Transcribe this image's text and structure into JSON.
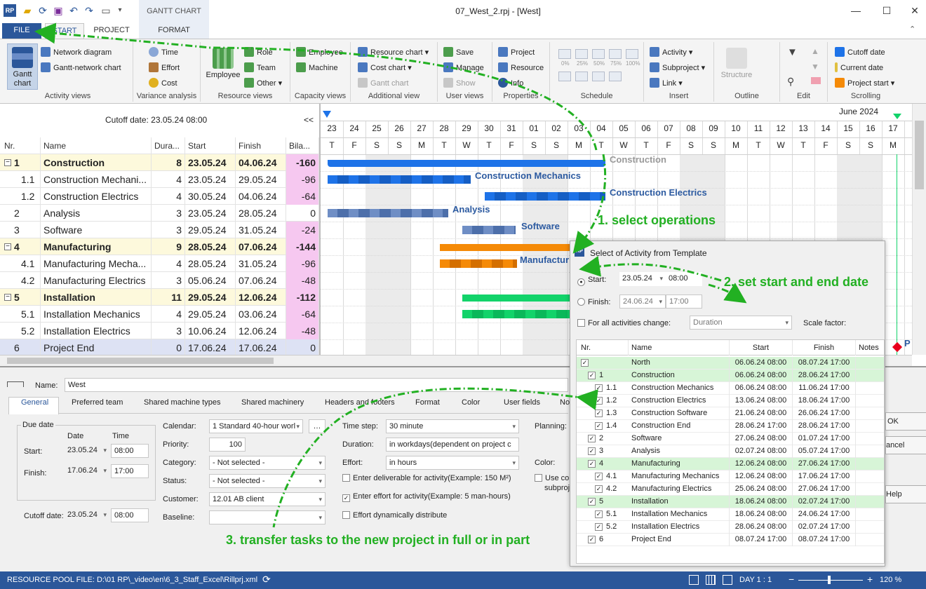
{
  "window": {
    "title": "07_West_2.rpj - [West]",
    "context_tab": "GANTT CHART"
  },
  "tabs": [
    {
      "label": "FILE"
    },
    {
      "label": "START"
    },
    {
      "label": "PROJECT"
    },
    {
      "label": "FORMAT"
    }
  ],
  "ribbon": {
    "activity_views": {
      "label": "Activity views",
      "gantt": "Gantt chart",
      "network": "Network diagram",
      "gantt_network": "Gantt-network chart"
    },
    "variance": {
      "label": "Variance analysis",
      "time": "Time",
      "effort": "Effort",
      "cost": "Cost"
    },
    "resource_views": {
      "label": "Resource views",
      "employee": "Employee",
      "role": "Role",
      "team": "Team",
      "other": "Other"
    },
    "capacity_views": {
      "label": "Capacity views",
      "employee": "Employee",
      "machine": "Machine"
    },
    "additional_view": {
      "label": "Additional view",
      "resource_chart": "Resource chart",
      "cost_chart": "Cost chart",
      "gantt_chart": "Gantt chart"
    },
    "user_views": {
      "label": "User views",
      "save": "Save",
      "manage": "Manage",
      "show": "Show"
    },
    "properties": {
      "label": "Properties",
      "project": "Project",
      "resource": "Resource",
      "info": "Info"
    },
    "schedule": {
      "label": "Schedule",
      "pcts": [
        "0%",
        "25%",
        "50%",
        "75%",
        "100%"
      ]
    },
    "insert": {
      "label": "Insert",
      "activity": "Activity",
      "subproject": "Subproject",
      "link": "Link"
    },
    "outline": {
      "label": "Outline",
      "structure": "Structure"
    },
    "edit": {
      "label": "Edit"
    },
    "scrolling": {
      "label": "Scrolling",
      "cutoff": "Cutoff date",
      "current": "Current date",
      "project_start": "Project start"
    }
  },
  "left": {
    "cutoff": "Cutoff date: 23.05.24 08:00",
    "collapse": "<<",
    "headers": [
      "Nr.",
      "Name",
      "Dura...",
      "Start",
      "Finish",
      "Bila..."
    ],
    "rows": [
      {
        "nr": "1",
        "name": "Construction",
        "dur": "8",
        "start": "23.05.24",
        "finish": "04.06.24",
        "bal": "-160",
        "sum": true
      },
      {
        "nr": "1.1",
        "name": "Construction Mechani...",
        "dur": "4",
        "start": "23.05.24",
        "finish": "29.05.24",
        "bal": "-96"
      },
      {
        "nr": "1.2",
        "name": "Construction Electrics",
        "dur": "4",
        "start": "30.05.24",
        "finish": "04.06.24",
        "bal": "-64"
      },
      {
        "nr": "2",
        "name": "Analysis",
        "dur": "3",
        "start": "23.05.24",
        "finish": "28.05.24",
        "bal": "0"
      },
      {
        "nr": "3",
        "name": "Software",
        "dur": "3",
        "start": "29.05.24",
        "finish": "31.05.24",
        "bal": "-24"
      },
      {
        "nr": "4",
        "name": "Manufacturing",
        "dur": "9",
        "start": "28.05.24",
        "finish": "07.06.24",
        "bal": "-144",
        "sum": true
      },
      {
        "nr": "4.1",
        "name": "Manufacturing Mecha...",
        "dur": "4",
        "start": "28.05.24",
        "finish": "31.05.24",
        "bal": "-96"
      },
      {
        "nr": "4.2",
        "name": "Manufacturing Electrics",
        "dur": "3",
        "start": "05.06.24",
        "finish": "07.06.24",
        "bal": "-48"
      },
      {
        "nr": "5",
        "name": "Installation",
        "dur": "11",
        "start": "29.05.24",
        "finish": "12.06.24",
        "bal": "-112",
        "sum": true
      },
      {
        "nr": "5.1",
        "name": "Installation Mechanics",
        "dur": "4",
        "start": "29.05.24",
        "finish": "03.06.24",
        "bal": "-64"
      },
      {
        "nr": "5.2",
        "name": "Installation Electrics",
        "dur": "3",
        "start": "10.06.24",
        "finish": "12.06.24",
        "bal": "-48"
      },
      {
        "nr": "6",
        "name": "Project End",
        "dur": "0",
        "start": "17.06.24",
        "finish": "17.06.24",
        "bal": "0",
        "last": true
      }
    ]
  },
  "gantt": {
    "month": "June 2024",
    "days": [
      "23",
      "24",
      "25",
      "26",
      "27",
      "28",
      "29",
      "30",
      "31",
      "01",
      "02",
      "03",
      "04",
      "05",
      "06",
      "07",
      "08",
      "09",
      "10",
      "11",
      "12",
      "13",
      "14",
      "15",
      "16",
      "17"
    ],
    "letters": [
      "T",
      "F",
      "S",
      "S",
      "M",
      "T",
      "W",
      "T",
      "F",
      "S",
      "S",
      "M",
      "T",
      "W",
      "T",
      "F",
      "S",
      "S",
      "M",
      "T",
      "W",
      "T",
      "F",
      "S",
      "S",
      "M"
    ],
    "labels": {
      "construction": "Construction",
      "cmech": "Construction Mechanics",
      "celec": "Construction Electrics",
      "analysis": "Analysis",
      "software": "Software",
      "manuf": "Manufactur",
      "p": "P"
    }
  },
  "props": {
    "name_label": "Name:",
    "name_value": "West",
    "tabs": [
      "General",
      "Preferred team",
      "Shared machine types",
      "Shared machinery",
      "Headers and footers",
      "Format",
      "Color",
      "User fields",
      "No"
    ],
    "due_date": "Due date",
    "date_hdr": "Date",
    "time_hdr": "Time",
    "start_label": "Start:",
    "start_date": "23.05.24",
    "start_time": "08:00",
    "finish_label": "Finish:",
    "finish_date": "17.06.24",
    "finish_time": "17:00",
    "cutoff_label": "Cutoff date:",
    "cutoff_date": "23.05.24",
    "cutoff_time": "08:00",
    "calendar_label": "Calendar:",
    "calendar_value": "1 Standard 40-hour worl",
    "priority_label": "Priority:",
    "priority_value": "100",
    "category_label": "Category:",
    "category_value": "- Not selected -",
    "status_label": "Status:",
    "status_value": "- Not selected -",
    "customer_label": "Customer:",
    "customer_value": "12.01 AB client",
    "baseline_label": "Baseline:",
    "timestep_label": "Time step:",
    "timestep_value": "30 minute",
    "duration_label": "Duration:",
    "duration_value": "in workdays(dependent on project c",
    "effort_label": "Effort:",
    "effort_value": "in hours",
    "cb1": "Enter deliverable for activity(Example: 150 M²)",
    "cb2": "Enter effort for activity(Example: 5 man-hours)",
    "cb3": "Effort dynamically distribute",
    "planning_label": "Planning:",
    "color_label": "Color:",
    "use_co": "Use co",
    "subproj": "subproj"
  },
  "dialog": {
    "title": "Select of Activity from Template",
    "start_label": "Start:",
    "start_date": "23.05.24",
    "start_time": "08:00",
    "finish_label": "Finish:",
    "finish_date": "24.06.24",
    "finish_time": "17:00",
    "for_all": "For all activities change:",
    "for_all_value": "Duration",
    "scale": "Scale factor:",
    "headers": [
      "Nr.",
      "Name",
      "Start",
      "Finish",
      "Notes"
    ],
    "rows": [
      {
        "nr": "",
        "name": "North",
        "start": "06.06.24 08:00",
        "finish": "08.07.24 17:00",
        "lvl": 0,
        "green": true
      },
      {
        "nr": "1",
        "name": "Construction",
        "start": "06.06.24 08:00",
        "finish": "28.06.24 17:00",
        "lvl": 1,
        "green": true
      },
      {
        "nr": "1.1",
        "name": "Construction Mechanics",
        "start": "06.06.24 08:00",
        "finish": "11.06.24 17:00",
        "lvl": 2
      },
      {
        "nr": "1.2",
        "name": "Construction Electrics",
        "start": "13.06.24 08:00",
        "finish": "18.06.24 17:00",
        "lvl": 2
      },
      {
        "nr": "1.3",
        "name": "Construction Software",
        "start": "21.06.24 08:00",
        "finish": "26.06.24 17:00",
        "lvl": 2
      },
      {
        "nr": "1.4",
        "name": "Construction End",
        "start": "28.06.24 17:00",
        "finish": "28.06.24 17:00",
        "lvl": 2
      },
      {
        "nr": "2",
        "name": "Software",
        "start": "27.06.24 08:00",
        "finish": "01.07.24 17:00",
        "lvl": 1
      },
      {
        "nr": "3",
        "name": "Analysis",
        "start": "02.07.24 08:00",
        "finish": "05.07.24 17:00",
        "lvl": 1
      },
      {
        "nr": "4",
        "name": "Manufacturing",
        "start": "12.06.24 08:00",
        "finish": "27.06.24 17:00",
        "lvl": 1,
        "green": true
      },
      {
        "nr": "4.1",
        "name": "Manufacturing Mechanics",
        "start": "12.06.24 08:00",
        "finish": "17.06.24 17:00",
        "lvl": 2
      },
      {
        "nr": "4.2",
        "name": "Manufacturing Electrics",
        "start": "25.06.24 08:00",
        "finish": "27.06.24 17:00",
        "lvl": 2
      },
      {
        "nr": "5",
        "name": "Installation",
        "start": "18.06.24 08:00",
        "finish": "02.07.24 17:00",
        "lvl": 1,
        "green": true
      },
      {
        "nr": "5.1",
        "name": "Installation Mechanics",
        "start": "18.06.24 08:00",
        "finish": "24.06.24 17:00",
        "lvl": 2
      },
      {
        "nr": "5.2",
        "name": "Installation Electrics",
        "start": "28.06.24 08:00",
        "finish": "02.07.24 17:00",
        "lvl": 2
      },
      {
        "nr": "6",
        "name": "Project End",
        "start": "08.07.24 17:00",
        "finish": "08.07.24 17:00",
        "lvl": 1
      }
    ],
    "ok": "OK",
    "cancel": "ancel",
    "help": "Help"
  },
  "annotations": {
    "a1": "1. select operations",
    "a2": "2. set start and end date",
    "a3": "3. transfer tasks to the new project in full or in part"
  },
  "status": {
    "pool": "RESOURCE POOL FILE: D:\\01 RP\\_video\\en\\6_3_Staff_Excel\\Rillprj.xml",
    "day": "DAY 1 : 1",
    "zoom": "120 %"
  },
  "colors": {
    "blue": "#2b579a",
    "bar": "#1e73e8",
    "orange": "#f58a07",
    "green": "#12d36a",
    "annot": "#22b022"
  }
}
